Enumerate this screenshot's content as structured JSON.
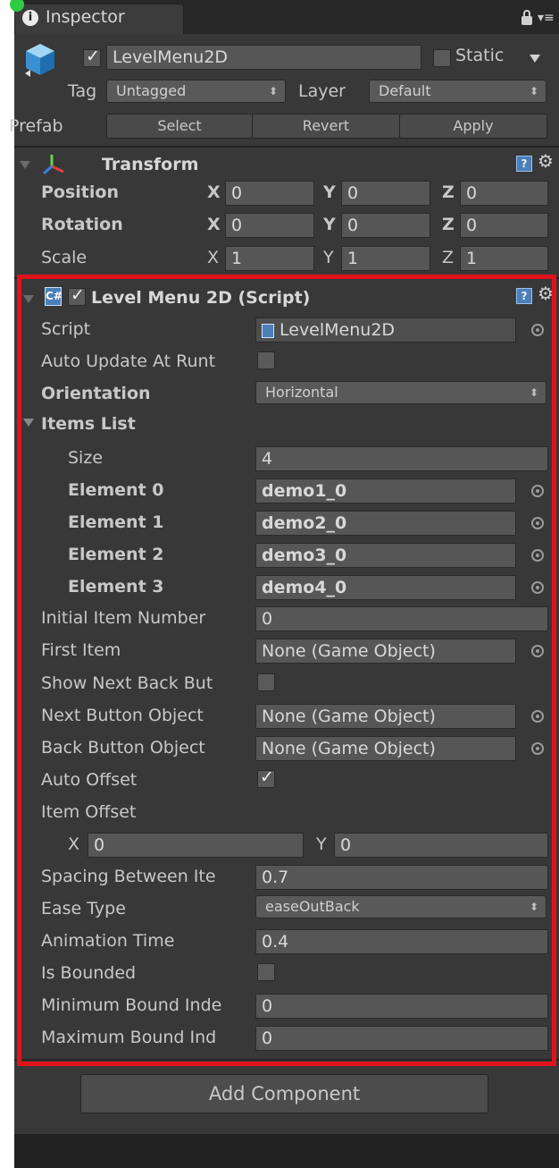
{
  "tab": {
    "title": "Inspector"
  },
  "object": {
    "name": "LevelMenu2D",
    "static_label": "Static",
    "active": true
  },
  "tag": {
    "label": "Tag",
    "value": "Untagged"
  },
  "layer": {
    "label": "Layer",
    "value": "Default"
  },
  "prefab": {
    "label": "Prefab",
    "select": "Select",
    "revert": "Revert",
    "apply": "Apply"
  },
  "transform": {
    "title": "Transform",
    "rows": [
      {
        "label": "Position",
        "x": "0",
        "y": "0",
        "z": "0"
      },
      {
        "label": "Rotation",
        "x": "0",
        "y": "0",
        "z": "0"
      },
      {
        "label": "Scale",
        "x": "1",
        "y": "1",
        "z": "1"
      }
    ],
    "axis": {
      "x": "X",
      "y": "Y",
      "z": "Z"
    }
  },
  "script_component": {
    "title": "Level Menu 2D (Script)",
    "enabled": true,
    "script_label": "Script",
    "script_value": "LevelMenu2D",
    "auto_update_label": "Auto Update At Runt",
    "orientation_label": "Orientation",
    "orientation_value": "Horizontal",
    "items_list_label": "Items List",
    "size_label": "Size",
    "size_value": "4",
    "elements": [
      {
        "label": "Element 0",
        "value": "demo1_0"
      },
      {
        "label": "Element 1",
        "value": "demo2_0"
      },
      {
        "label": "Element 2",
        "value": "demo3_0"
      },
      {
        "label": "Element 3",
        "value": "demo4_0"
      }
    ],
    "initial_item_label": "Initial Item Number",
    "initial_item_value": "0",
    "first_item_label": "First Item",
    "first_item_value": "None (Game Object)",
    "show_next_back_label": "Show Next Back But",
    "next_button_label": "Next Button Object",
    "next_button_value": "None (Game Object)",
    "back_button_label": "Back Button Object",
    "back_button_value": "None (Game Object)",
    "auto_offset_label": "Auto Offset",
    "auto_offset_checked": true,
    "item_offset_label": "Item Offset",
    "item_offset_x_label": "X",
    "item_offset_x": "0",
    "item_offset_y_label": "Y",
    "item_offset_y": "0",
    "spacing_label": "Spacing Between Ite",
    "spacing_value": "0.7",
    "ease_type_label": "Ease Type",
    "ease_type_value": "easeOutBack",
    "animation_time_label": "Animation Time",
    "animation_time_value": "0.4",
    "is_bounded_label": "Is Bounded",
    "min_bound_label": "Minimum Bound Indе",
    "min_bound_value": "0",
    "max_bound_label": "Maximum Bound Ind",
    "max_bound_value": "0"
  },
  "add_component": {
    "label": "Add Component"
  },
  "colors": {
    "panel": "#383838",
    "field": "#565656",
    "highlight": "#e0121b",
    "accent": "#4a7fb8"
  },
  "icons": [
    "info-icon",
    "lock-icon",
    "menu-icon",
    "cube-icon",
    "transform-axes-icon",
    "help-icon",
    "gear-icon",
    "script-icon",
    "object-picker-icon"
  ]
}
